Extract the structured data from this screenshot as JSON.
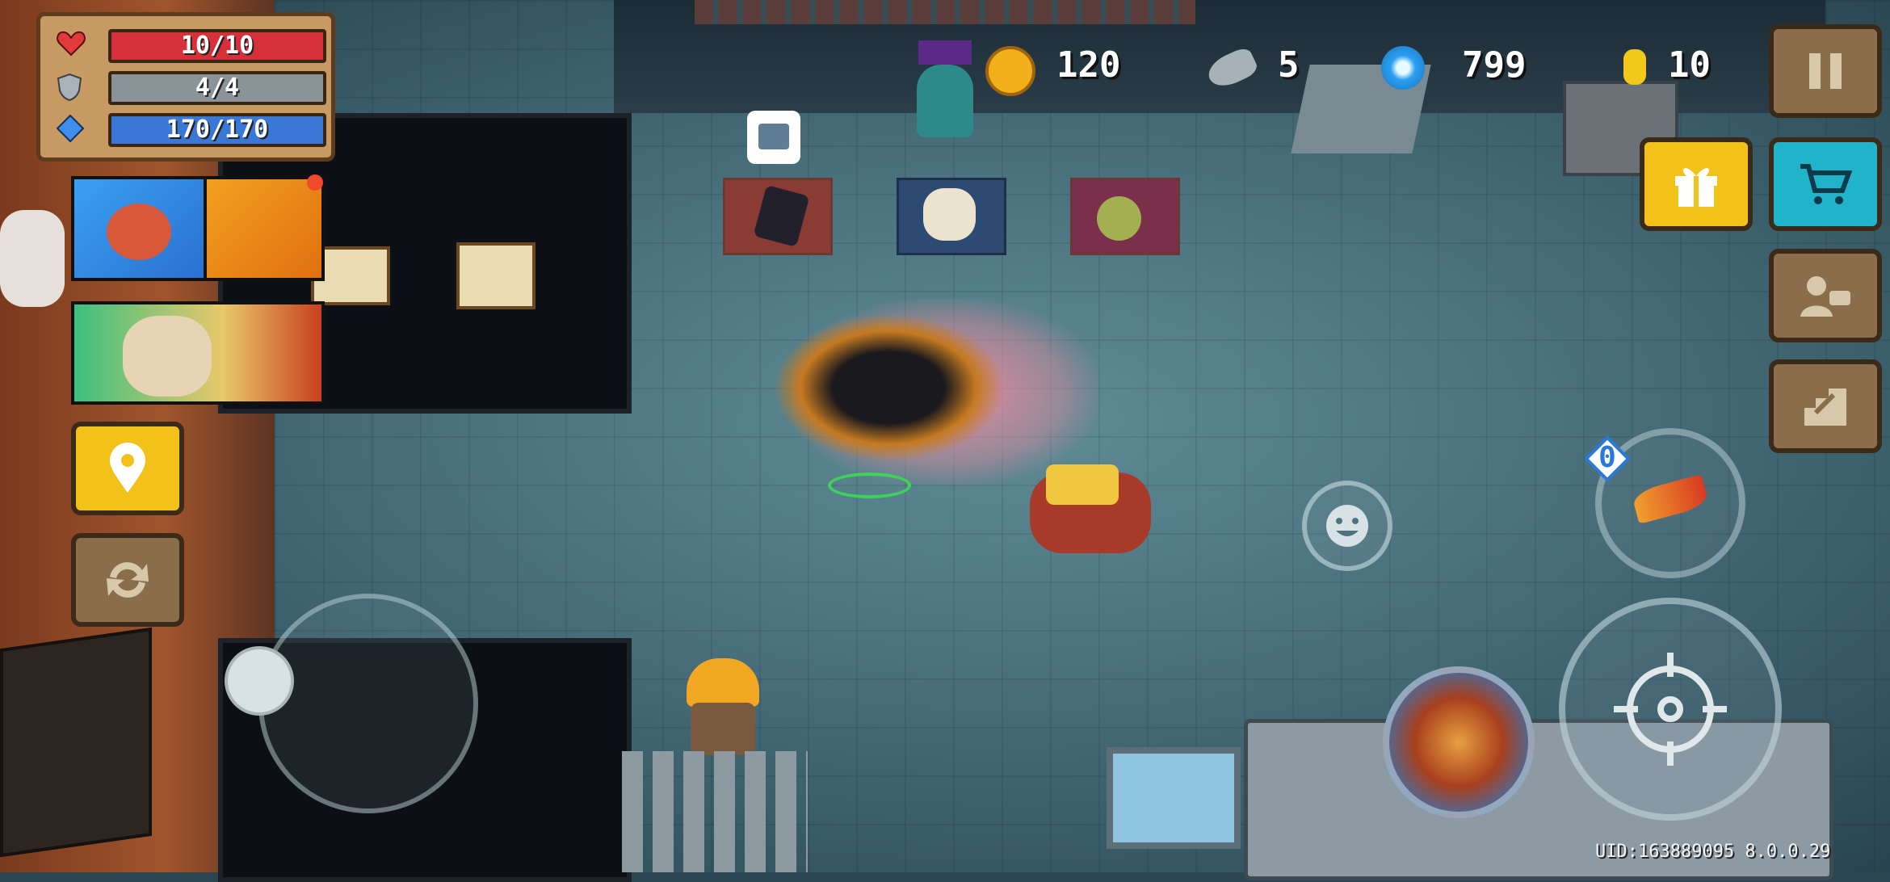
{
  "hud": {
    "health": {
      "label": "10/10",
      "current": 10,
      "max": 10,
      "color": "#d8303a"
    },
    "armor": {
      "label": "4/4",
      "current": 4,
      "max": 4,
      "color": "#8a9398"
    },
    "energy": {
      "label": "170/170",
      "current": 170,
      "max": 170,
      "color": "#3a78d8"
    }
  },
  "currencies": {
    "gold_coins": "120",
    "fish": "5",
    "gems": "799",
    "tokens": "10"
  },
  "icons": {
    "heart": "heart-icon",
    "shield": "shield-icon",
    "energy": "energy-icon",
    "coin": "gold-coin-icon",
    "fish": "fish-icon",
    "gem": "gem-icon",
    "token": "token-icon",
    "pause": "pause-icon",
    "gift": "gift-icon",
    "shop": "shop-cart-icon",
    "profile": "profile-icon",
    "exit": "exit-icon",
    "location": "location-pin-icon",
    "swap": "swap-icon",
    "emote": "smiley-icon",
    "aim": "crosshair-icon",
    "weapon_switch": "weapon-switch-icon"
  },
  "weapon_swap": {
    "energy_cost": "0"
  },
  "footer": {
    "uid": "UID:163889095 8.0.0.29"
  },
  "colors": {
    "gift_button": "#f2c21b",
    "shop_button": "#21b3c9",
    "location_button": "#f2c21b",
    "panel_brown": "#8a6e4c"
  }
}
